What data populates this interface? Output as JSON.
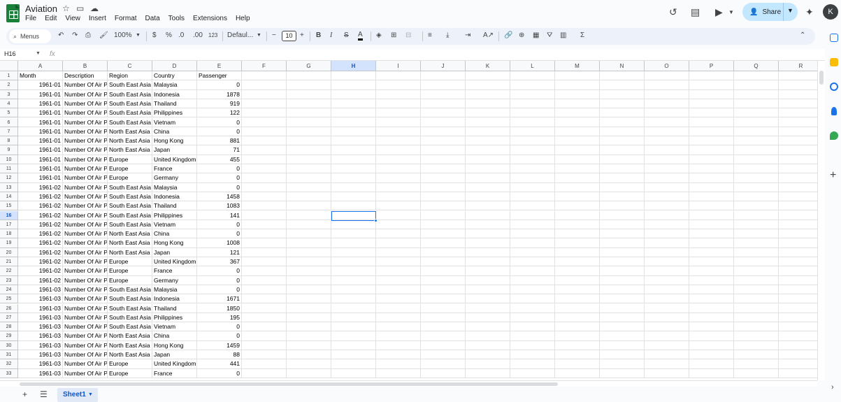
{
  "app": {
    "title": "Aviation",
    "avatar_letter": "K",
    "share_label": "Share"
  },
  "menubar": [
    "File",
    "Edit",
    "View",
    "Insert",
    "Format",
    "Data",
    "Tools",
    "Extensions",
    "Help"
  ],
  "toolbar": {
    "menus_label": "Menus",
    "zoom": "100%",
    "currency": "$",
    "percent": "%",
    "decrease_decimal": ".0",
    "increase_decimal": ".00",
    "number_format": "123",
    "font_family": "Defaul...",
    "font_size": "10",
    "bold": "B",
    "italic": "I",
    "strikethrough": "S",
    "text_color": "A",
    "sum_symbol": "Σ"
  },
  "formula_bar": {
    "name_box": "H16",
    "fx": "fx"
  },
  "columns": [
    "A",
    "B",
    "C",
    "D",
    "E",
    "F",
    "G",
    "H",
    "I",
    "J",
    "K",
    "L",
    "M",
    "N",
    "O",
    "P",
    "Q",
    "R"
  ],
  "selected_cell": {
    "col": "H",
    "row": 16
  },
  "rows": [
    [
      "Month",
      "Description",
      "Region",
      "Country",
      "Passenger"
    ],
    [
      "1961-01",
      "Number Of Air P",
      "South East Asia",
      "Malaysia",
      "0"
    ],
    [
      "1961-01",
      "Number Of Air P",
      "South East Asia",
      "Indonesia",
      "1878"
    ],
    [
      "1961-01",
      "Number Of Air P",
      "South East Asia",
      "Thailand",
      "919"
    ],
    [
      "1961-01",
      "Number Of Air P",
      "South East Asia",
      "Philippines",
      "122"
    ],
    [
      "1961-01",
      "Number Of Air P",
      "South East Asia",
      "Vietnam",
      "0"
    ],
    [
      "1961-01",
      "Number Of Air P",
      "North East Asia",
      "China",
      "0"
    ],
    [
      "1961-01",
      "Number Of Air P",
      "North East Asia",
      "Hong Kong",
      "881"
    ],
    [
      "1961-01",
      "Number Of Air P",
      "North East Asia",
      "Japan",
      "71"
    ],
    [
      "1961-01",
      "Number Of Air P",
      "Europe",
      "United Kingdom",
      "455"
    ],
    [
      "1961-01",
      "Number Of Air P",
      "Europe",
      "France",
      "0"
    ],
    [
      "1961-01",
      "Number Of Air P",
      "Europe",
      "Germany",
      "0"
    ],
    [
      "1961-02",
      "Number Of Air P",
      "South East Asia",
      "Malaysia",
      "0"
    ],
    [
      "1961-02",
      "Number Of Air P",
      "South East Asia",
      "Indonesia",
      "1458"
    ],
    [
      "1961-02",
      "Number Of Air P",
      "South East Asia",
      "Thailand",
      "1083"
    ],
    [
      "1961-02",
      "Number Of Air P",
      "South East Asia",
      "Philippines",
      "141"
    ],
    [
      "1961-02",
      "Number Of Air P",
      "South East Asia",
      "Vietnam",
      "0"
    ],
    [
      "1961-02",
      "Number Of Air P",
      "North East Asia",
      "China",
      "0"
    ],
    [
      "1961-02",
      "Number Of Air P",
      "North East Asia",
      "Hong Kong",
      "1008"
    ],
    [
      "1961-02",
      "Number Of Air P",
      "North East Asia",
      "Japan",
      "121"
    ],
    [
      "1961-02",
      "Number Of Air P",
      "Europe",
      "United Kingdom",
      "367"
    ],
    [
      "1961-02",
      "Number Of Air P",
      "Europe",
      "France",
      "0"
    ],
    [
      "1961-02",
      "Number Of Air P",
      "Europe",
      "Germany",
      "0"
    ],
    [
      "1961-03",
      "Number Of Air P",
      "South East Asia",
      "Malaysia",
      "0"
    ],
    [
      "1961-03",
      "Number Of Air P",
      "South East Asia",
      "Indonesia",
      "1671"
    ],
    [
      "1961-03",
      "Number Of Air P",
      "South East Asia",
      "Thailand",
      "1850"
    ],
    [
      "1961-03",
      "Number Of Air P",
      "South East Asia",
      "Philippines",
      "195"
    ],
    [
      "1961-03",
      "Number Of Air P",
      "South East Asia",
      "Vietnam",
      "0"
    ],
    [
      "1961-03",
      "Number Of Air P",
      "North East Asia",
      "China",
      "0"
    ],
    [
      "1961-03",
      "Number Of Air P",
      "North East Asia",
      "Hong Kong",
      "1459"
    ],
    [
      "1961-03",
      "Number Of Air P",
      "North East Asia",
      "Japan",
      "88"
    ],
    [
      "1961-03",
      "Number Of Air P",
      "Europe",
      "United Kingdom",
      "441"
    ],
    [
      "1961-03",
      "Number Of Air P",
      "Europe",
      "France",
      "0"
    ]
  ],
  "sheet_tab": "Sheet1",
  "colors": {
    "accent": "#1a73e8",
    "share_bg": "#c2e7ff",
    "logo": "#188038",
    "toolbar_bg": "#edf2fa"
  }
}
